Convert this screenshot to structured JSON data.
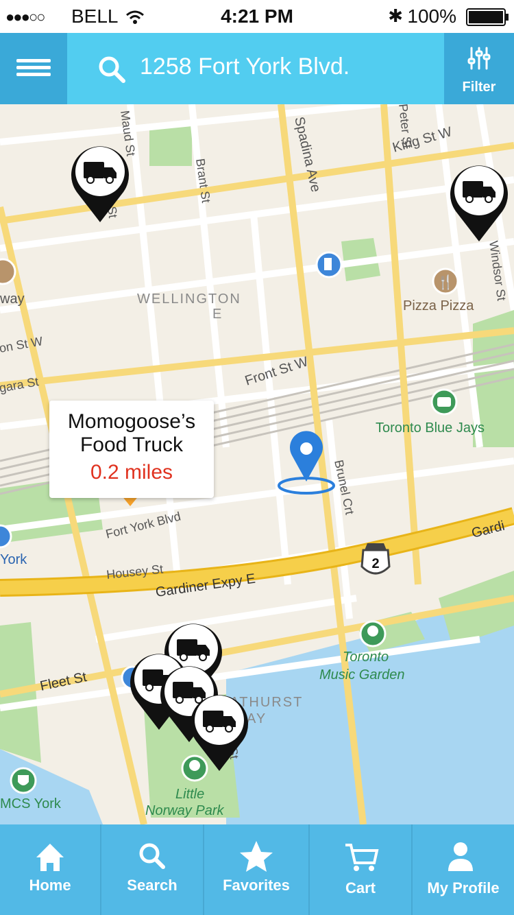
{
  "status": {
    "carrier": "BELL",
    "time": "4:21 PM",
    "battery": "100%",
    "signal_icon": "signal-dots-icon",
    "wifi_icon": "wifi-icon",
    "bluetooth_icon": "bluetooth-icon"
  },
  "search": {
    "value": "1258 Fort York Blvd.",
    "filter_label": "Filter"
  },
  "callout": {
    "name": "Momogoose’s Food Truck",
    "distance": "0.2 miles"
  },
  "map": {
    "streets": [
      "King St W",
      "Spadina Ave",
      "Maud St",
      "Brant St",
      "Peter St",
      "Windsor St",
      "Front St W",
      "Brunel Crt",
      "Fort York Blvd",
      "Housey St",
      "Gardiner Expy E",
      "Fleet St",
      "Gardi",
      "WELLINGTON",
      "E",
      "way",
      "on St W",
      "gara St",
      "York",
      "Toronto Blue Jays",
      "Pizza Pizza",
      "Toronto Music Garden",
      "Little Norway Park",
      "MCS York",
      "BATHURST",
      "QUAY",
      "2",
      "and St",
      "st St"
    ],
    "selected_pin_color": "#f5a12a",
    "location_pin_color": "#2b7fdc"
  },
  "tabs": [
    {
      "label": "Home",
      "icon": "home-icon"
    },
    {
      "label": "Search",
      "icon": "search-icon"
    },
    {
      "label": "Favorites",
      "icon": "star-icon"
    },
    {
      "label": "Cart",
      "icon": "cart-icon"
    },
    {
      "label": "My Profile",
      "icon": "profile-icon"
    }
  ]
}
